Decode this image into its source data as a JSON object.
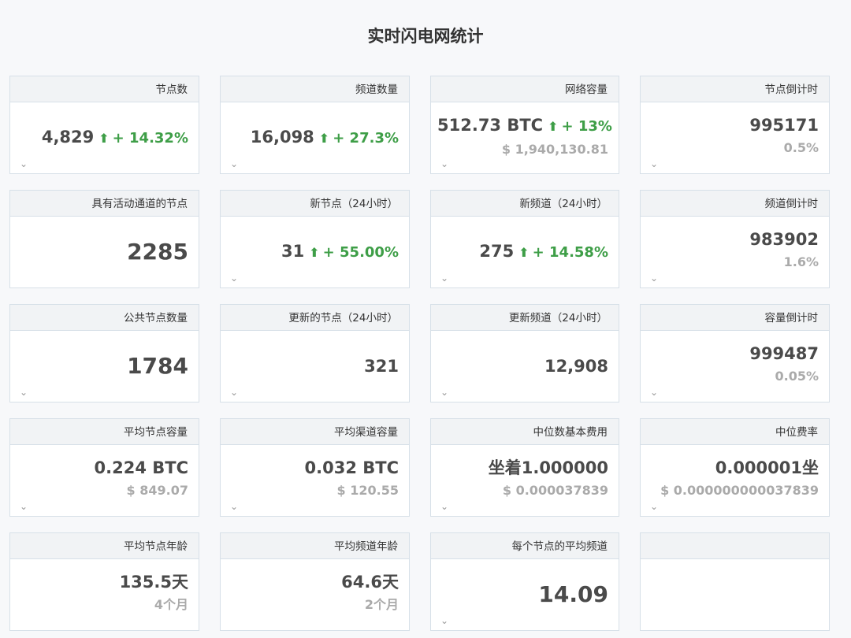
{
  "page": {
    "title": "实时闪电网统计"
  },
  "cards": [
    {
      "title": "节点数",
      "value": "4,829",
      "change": "+ 14.32%",
      "expandable": true
    },
    {
      "title": "频道数量",
      "value": "16,098",
      "change": "+ 27.3%",
      "expandable": true
    },
    {
      "title": "网络容量",
      "value": "512.73 BTC",
      "change": "+ 13%",
      "sub": "$ 1,940,130.81",
      "expandable": true
    },
    {
      "title": "节点倒计时",
      "value": "995171",
      "sub": "0.5%",
      "expandable": true
    },
    {
      "title": "具有活动通道的节点",
      "value": "2285",
      "big": true,
      "expandable": false
    },
    {
      "title": "新节点（24小时）",
      "value": "31",
      "change": "+ 55.00%",
      "expandable": true
    },
    {
      "title": "新频道（24小时）",
      "value": "275",
      "change": "+ 14.58%",
      "expandable": true
    },
    {
      "title": "频道倒计时",
      "value": "983902",
      "sub": "1.6%",
      "expandable": true
    },
    {
      "title": "公共节点数量",
      "value": "1784",
      "big": true,
      "expandable": true
    },
    {
      "title": "更新的节点（24小时）",
      "value": "321",
      "expandable": true
    },
    {
      "title": "更新频道（24小时）",
      "value": "12,908",
      "expandable": true
    },
    {
      "title": "容量倒计时",
      "value": "999487",
      "sub": "0.05%",
      "expandable": true
    },
    {
      "title": "平均节点容量",
      "value": "0.224 BTC",
      "sub": "$ 849.07",
      "expandable": true
    },
    {
      "title": "平均渠道容量",
      "value": "0.032 BTC",
      "sub": "$ 120.55",
      "expandable": true
    },
    {
      "title": "中位数基本费用",
      "value": "坐着1.000000",
      "sub": "$ 0.000037839",
      "expandable": true
    },
    {
      "title": "中位费率",
      "value": "0.000001坐",
      "sub": "$ 0.000000000037839",
      "expandable": true
    },
    {
      "title": "平均节点年龄",
      "value": "135.5天",
      "sub": "4个月",
      "expandable": false
    },
    {
      "title": "平均频道年龄",
      "value": "64.6天",
      "sub": "2个月",
      "expandable": false
    },
    {
      "title": "每个节点的平均频道",
      "value": "14.09",
      "big": true,
      "expandable": true
    },
    {
      "title": "",
      "value": "",
      "expandable": false
    }
  ],
  "icons": {
    "up_arrow": "arrow-up-icon",
    "expand": "chevron-down-icon"
  },
  "colors": {
    "positive": "#3e9e47",
    "muted": "#aaaaaa",
    "value": "#4a4a4a"
  }
}
